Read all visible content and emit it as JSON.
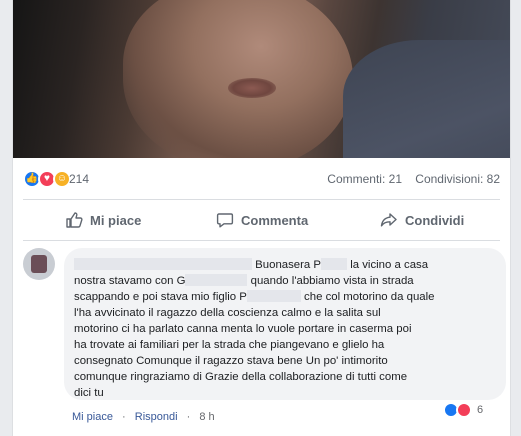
{
  "post": {
    "reaction_count": "214",
    "comments_text": "Commenti: 21",
    "shares_text": "Condivisioni: 82",
    "reaction_icons": [
      "like-icon",
      "love-icon",
      "care-icon"
    ]
  },
  "actions": {
    "like": "Mi piace",
    "comment": "Commenta",
    "share": "Condividi"
  },
  "comment": {
    "lines": [
      [
        "",
        "Buonasera P",
        "la vicino a casa"
      ],
      [
        "nostra stavamo con G",
        "quando l'abbiamo vista in strada"
      ],
      [
        "scappando e poi stava mio figlio P",
        "che col motorino da quale"
      ],
      [
        "l'ha avvicinato il ragazzo della coscienza calmo e la salita sul"
      ],
      [
        "motorino ci ha parlato canna menta lo vuole portare in caserma poi"
      ],
      [
        "ha trovate ai familiari per la strada che piangevano e glielo ha"
      ],
      [
        "consegnato Comunque il ragazzo stava bene Un po' intimorito"
      ],
      [
        "comunque ringraziamo di Grazie della collaborazione di tutti come"
      ],
      [
        "dici tu"
      ]
    ],
    "like_link": "Mi piace",
    "reply_link": "Rispondi",
    "time": "8 h",
    "reaction_count": "6"
  },
  "colors": {
    "facebook_blue": "#1877f2",
    "love_red": "#f33e58",
    "care_yellow": "#f7b125"
  }
}
